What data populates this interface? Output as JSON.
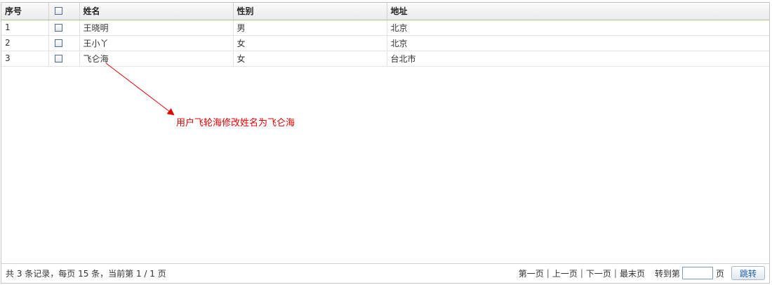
{
  "table": {
    "columns": [
      "序号",
      "",
      "姓名",
      "性别",
      "地址"
    ],
    "rows": [
      {
        "no": "1",
        "name": "王晓明",
        "gender": "男",
        "address": "北京"
      },
      {
        "no": "2",
        "name": "王小丫",
        "gender": "女",
        "address": "北京"
      },
      {
        "no": "3",
        "name": "飞仑海",
        "gender": "女",
        "address": "台北市"
      }
    ]
  },
  "annotation": {
    "text": "用户飞轮海修改姓名为飞仑海",
    "color": "#e60000"
  },
  "footer": {
    "summary": "共 3 条记录，每页 15 条，当前第 1 / 1 页",
    "first": "第一页",
    "prev": "上一页",
    "next": "下一页",
    "last": "最末页",
    "separator": "|",
    "goto_label": "转到第",
    "goto_value": "",
    "goto_unit": "页",
    "jump_button": "跳转"
  }
}
